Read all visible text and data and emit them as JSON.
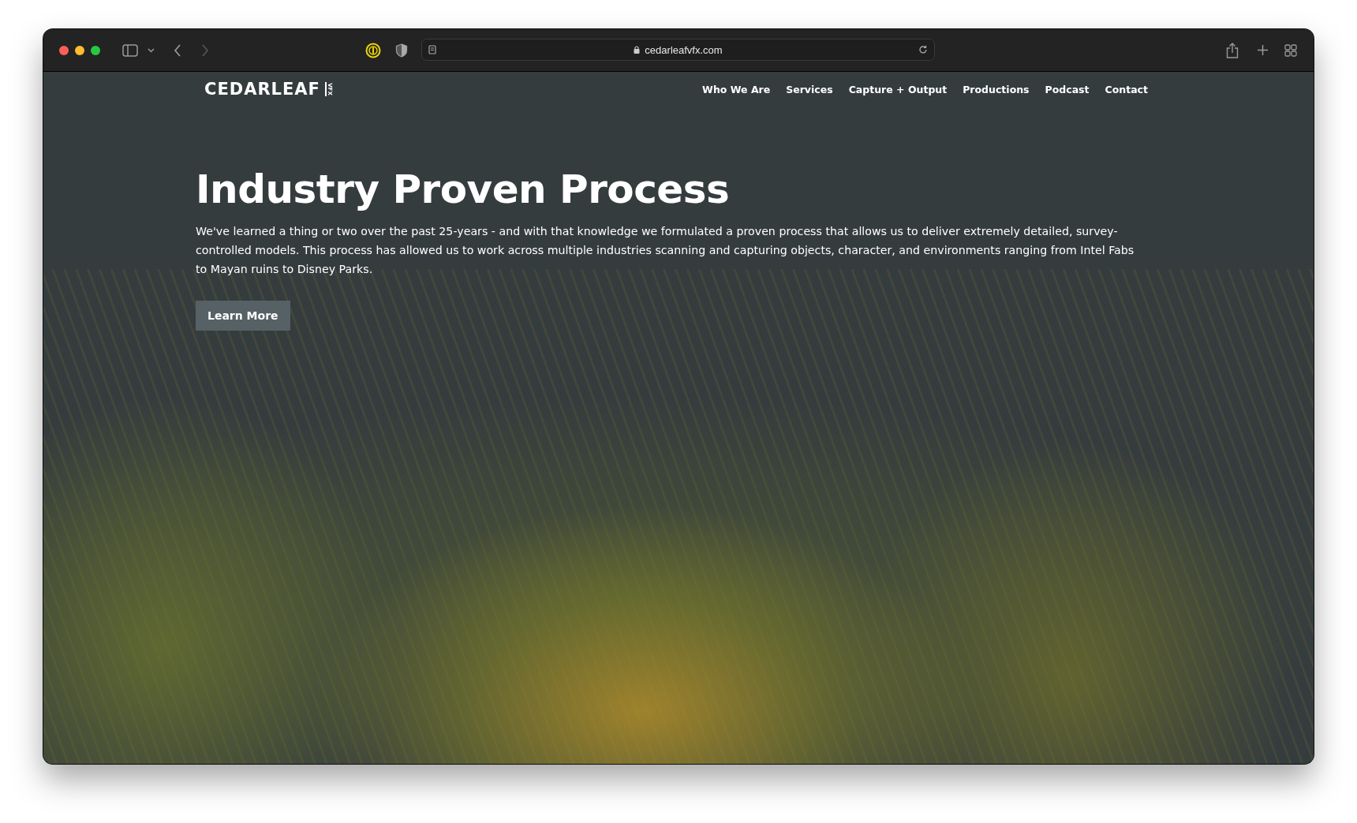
{
  "browser": {
    "url": "cedarleafvfx.com"
  },
  "site": {
    "logo": "CEDARLEAF",
    "logo_suffix": "VFX",
    "nav": [
      {
        "label": "Who We Are"
      },
      {
        "label": "Services"
      },
      {
        "label": "Capture + Output"
      },
      {
        "label": "Productions"
      },
      {
        "label": "Podcast"
      },
      {
        "label": "Contact"
      }
    ]
  },
  "hero": {
    "title": "Industry Proven Process",
    "body": "We've learned a thing or two over the past 25-years - and with that knowledge we formulated a proven process that allows us to deliver extremely detailed, survey-controlled models. This process has allowed us to work across multiple industries scanning and capturing objects, character, and environments ranging from Intel Fabs to Mayan ruins to Disney Parks.",
    "button": "Learn More"
  }
}
